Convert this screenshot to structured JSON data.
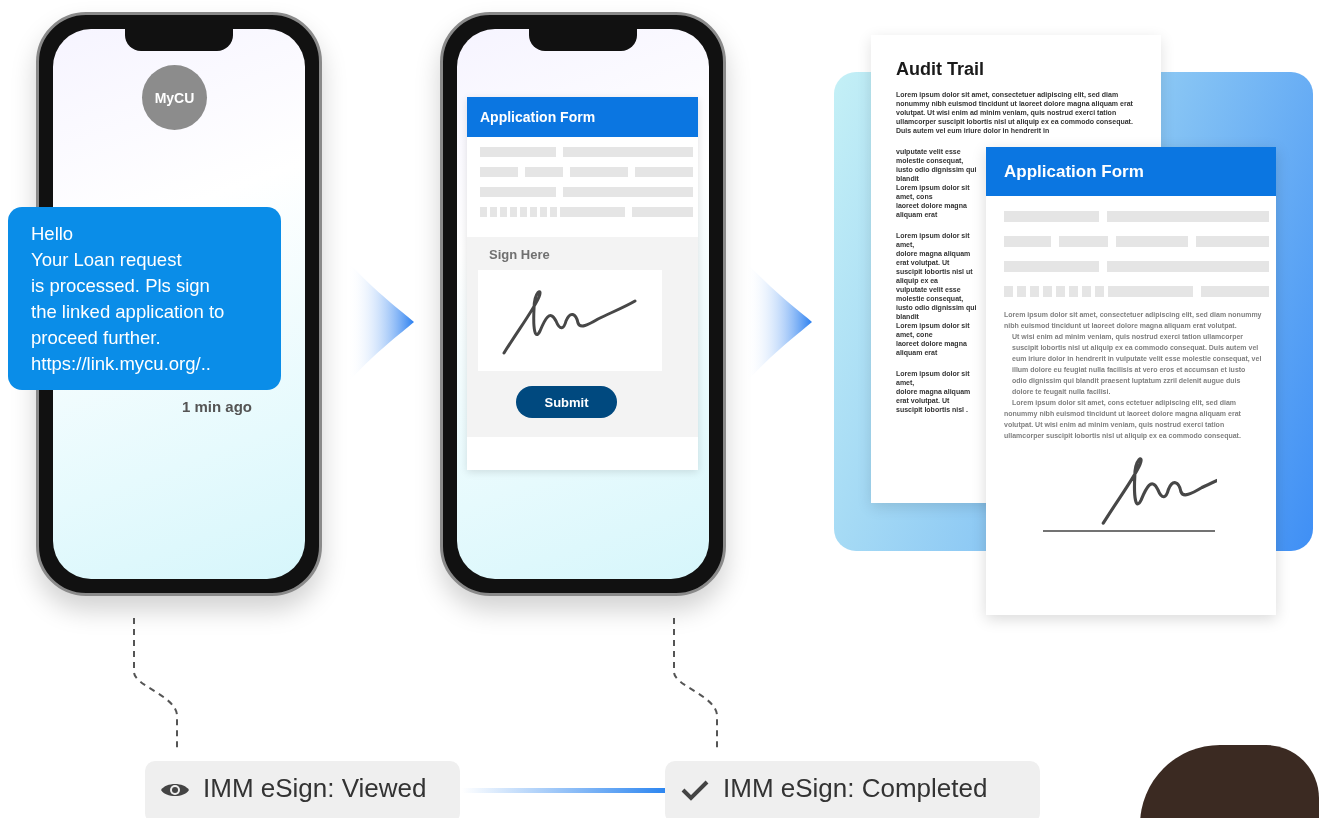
{
  "message_phone": {
    "avatar": "MyCU",
    "message_lines": [
      "Hello",
      "Your Loan request",
      "is processed. Pls sign",
      "the linked application to",
      "proceed further.",
      "https://link.mycu.org/.."
    ],
    "time": "1 min ago"
  },
  "form_phone": {
    "title": "Application Form",
    "sign_label": "Sign Here",
    "submit": "Submit"
  },
  "audit_trail": {
    "title": "Audit Trail",
    "lead": "Lorem ipsum dolor sit amet, consectetuer adipiscing elit, sed diam nonummy nibh euismod tincidunt ut laoreet dolore magna aliquam erat volutpat. Ut wisi enim ad minim veniam, quis nostrud exerci tation ullamcorper suscipit lobortis nisl ut aliquip ex ea commodo consequat. Duis autem vel eum iriure dolor in hendrerit in",
    "fragment_groups": [
      [
        "vulputate velit esse molestie consequat,",
        "iusto odio dignissim qui blandit",
        "Lorem ipsum dolor sit amet, cons",
        "laoreet dolore magna aliquam erat"
      ],
      [
        "Lorem ipsum dolor sit amet,",
        "dolore magna aliquam erat volutpat. Ut",
        "suscipit lobortis nisl ut aliquip ex ea",
        "vulputate velit esse molestie consequat,",
        "iusto odio dignissim qui blandit",
        "Lorem ipsum dolor sit amet, cone",
        "laoreet dolore magna aliquam erat"
      ],
      [
        "Lorem ipsum dolor sit amet,",
        "dolore magna aliquam erat volutpat. Ut",
        "suscipit lobortis nisl ."
      ]
    ]
  },
  "application_form": {
    "title": "Application Form",
    "paragraphs": [
      {
        "kind": "plain",
        "text": "Lorem ipsum dolor sit amet, consectetuer adipiscing elit, sed diam nonummy nibh euismod tincidunt ut laoreet dolore magna aliquam erat volutpat."
      },
      {
        "kind": "indented",
        "text": "Ut wisi enim ad minim veniam, quis nostrud exerci tation ullamcorper suscipit lobortis nisl ut aliquip ex ea commodo consequat. Duis autem vel eum iriure dolor in hendrerit in vulputate velit esse molestie consequat, vel illum dolore eu feugiat nulla facilisis at vero eros et accumsan et iusto odio dignissim qui blandit praesent luptatum zzril delenit augue duis dolore te feugait nulla facilisi."
      },
      {
        "kind": "first-indent",
        "text": "Lorem ipsum dolor sit amet, cons ectetuer adipiscing elit, sed diam nonummy nibh euismod tincidunt ut laoreet dolore magna aliquam erat volutpat. Ut wisi enim ad minim veniam, quis nostrud exerci tation ullamcorper suscipit lobortis nisl ut aliquip ex ea commodo consequat."
      }
    ]
  },
  "statuses": [
    {
      "kind": "eye",
      "label": "IMM eSign: Viewed"
    },
    {
      "kind": "check",
      "label": "IMM eSign: Completed"
    }
  ]
}
